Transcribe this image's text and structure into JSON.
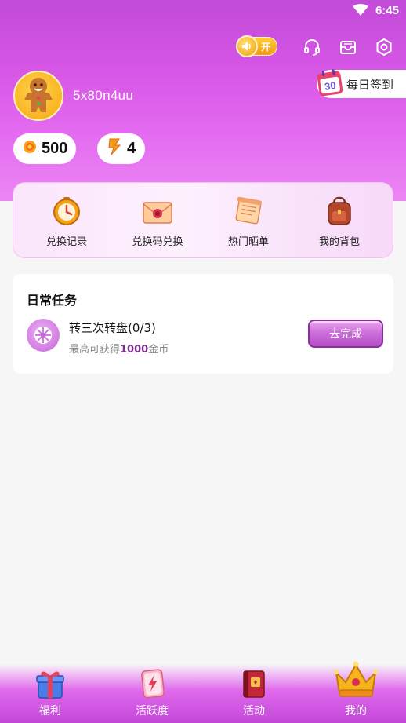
{
  "status_bar": {
    "time": "6:45",
    "wifi_icon": "wifi-icon"
  },
  "toolbar": {
    "sound_toggle_label": "开",
    "icons": [
      "speaker-icon",
      "headset-icon",
      "mailbox-icon",
      "settings-icon"
    ]
  },
  "profile": {
    "username": "5x80n4uu",
    "avatar_icon": "gingerbread-avatar"
  },
  "daily_checkin": {
    "label": "每日签到",
    "calendar_number": "30"
  },
  "stats": [
    {
      "icon": "coin-icon",
      "value": "500"
    },
    {
      "icon": "lightning-icon",
      "value": "4"
    }
  ],
  "features": [
    {
      "label": "兑换记录",
      "icon": "clock-icon"
    },
    {
      "label": "兑换码兑换",
      "icon": "envelope-icon"
    },
    {
      "label": "热门晒单",
      "icon": "scroll-icon"
    },
    {
      "label": "我的背包",
      "icon": "backpack-icon"
    }
  ],
  "tasks": {
    "title": "日常任务",
    "items": [
      {
        "name": "转三次转盘(0/3)",
        "reward_prefix": "最高可获得",
        "reward_amount": "1000",
        "reward_suffix": "金币",
        "button": "去完成",
        "icon": "wheel-icon"
      }
    ]
  },
  "bottom_nav": [
    {
      "label": "福利",
      "icon": "gift-icon"
    },
    {
      "label": "活跃度",
      "icon": "card-icon"
    },
    {
      "label": "活动",
      "icon": "book-icon"
    },
    {
      "label": "我的",
      "icon": "crown-icon",
      "active": true
    }
  ],
  "colors": {
    "brand": "#d656e6",
    "button": "#cf6fdc",
    "reward_amount": "#7b2f8f"
  }
}
